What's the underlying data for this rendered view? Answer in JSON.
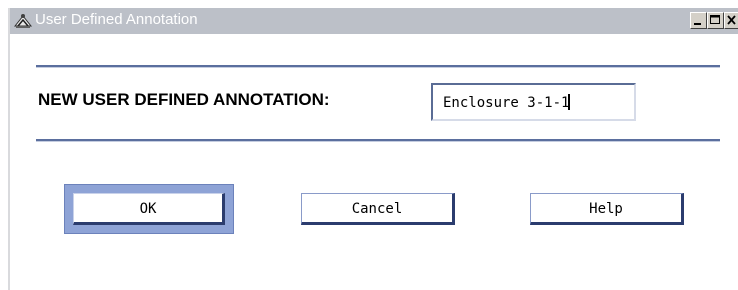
{
  "window": {
    "title": "User Defined Annotation",
    "title_icon": "app-logo-icon",
    "controls": {
      "minimize_icon": "minimize-icon",
      "maximize_icon": "maximize-icon",
      "close_icon": "close-icon"
    }
  },
  "form": {
    "label": "NEW USER DEFINED ANNOTATION:",
    "annotation_value": "Enclosure 3-1-1"
  },
  "buttons": {
    "ok": "OK",
    "cancel": "Cancel",
    "help": "Help"
  },
  "colors": {
    "titlebar": "#bcc0c8",
    "separator": "#5b6f9e",
    "ok_focus_frame": "#8ea3d6",
    "button_shadow": "#2b3c6e"
  }
}
